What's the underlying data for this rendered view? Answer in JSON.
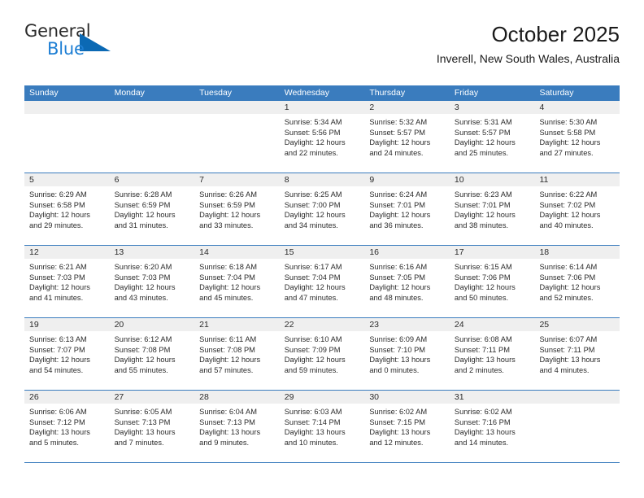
{
  "brand": {
    "name_top": "General",
    "name_bottom": "Blue",
    "triangle_icon": "brand-triangle-icon",
    "color_top": "#2b2b2b",
    "color_bottom": "#1e7fd4"
  },
  "header": {
    "title": "October 2025",
    "subtitle": "Inverell, New South Wales, Australia"
  },
  "theme": {
    "header_bg": "#3a7cbe",
    "header_text": "#ffffff",
    "daynum_bg": "#efefef",
    "cell_bg": "#ffffff",
    "text": "#2b2b2b",
    "rule": "#3a7cbe"
  },
  "calendar": {
    "weekday_headers": [
      "Sunday",
      "Monday",
      "Tuesday",
      "Wednesday",
      "Thursday",
      "Friday",
      "Saturday"
    ],
    "weeks": [
      [
        {
          "day": "",
          "lines": []
        },
        {
          "day": "",
          "lines": []
        },
        {
          "day": "",
          "lines": []
        },
        {
          "day": "1",
          "lines": [
            "Sunrise: 5:34 AM",
            "Sunset: 5:56 PM",
            "Daylight: 12 hours",
            "and 22 minutes."
          ]
        },
        {
          "day": "2",
          "lines": [
            "Sunrise: 5:32 AM",
            "Sunset: 5:57 PM",
            "Daylight: 12 hours",
            "and 24 minutes."
          ]
        },
        {
          "day": "3",
          "lines": [
            "Sunrise: 5:31 AM",
            "Sunset: 5:57 PM",
            "Daylight: 12 hours",
            "and 25 minutes."
          ]
        },
        {
          "day": "4",
          "lines": [
            "Sunrise: 5:30 AM",
            "Sunset: 5:58 PM",
            "Daylight: 12 hours",
            "and 27 minutes."
          ]
        }
      ],
      [
        {
          "day": "5",
          "lines": [
            "Sunrise: 6:29 AM",
            "Sunset: 6:58 PM",
            "Daylight: 12 hours",
            "and 29 minutes."
          ]
        },
        {
          "day": "6",
          "lines": [
            "Sunrise: 6:28 AM",
            "Sunset: 6:59 PM",
            "Daylight: 12 hours",
            "and 31 minutes."
          ]
        },
        {
          "day": "7",
          "lines": [
            "Sunrise: 6:26 AM",
            "Sunset: 6:59 PM",
            "Daylight: 12 hours",
            "and 33 minutes."
          ]
        },
        {
          "day": "8",
          "lines": [
            "Sunrise: 6:25 AM",
            "Sunset: 7:00 PM",
            "Daylight: 12 hours",
            "and 34 minutes."
          ]
        },
        {
          "day": "9",
          "lines": [
            "Sunrise: 6:24 AM",
            "Sunset: 7:01 PM",
            "Daylight: 12 hours",
            "and 36 minutes."
          ]
        },
        {
          "day": "10",
          "lines": [
            "Sunrise: 6:23 AM",
            "Sunset: 7:01 PM",
            "Daylight: 12 hours",
            "and 38 minutes."
          ]
        },
        {
          "day": "11",
          "lines": [
            "Sunrise: 6:22 AM",
            "Sunset: 7:02 PM",
            "Daylight: 12 hours",
            "and 40 minutes."
          ]
        }
      ],
      [
        {
          "day": "12",
          "lines": [
            "Sunrise: 6:21 AM",
            "Sunset: 7:03 PM",
            "Daylight: 12 hours",
            "and 41 minutes."
          ]
        },
        {
          "day": "13",
          "lines": [
            "Sunrise: 6:20 AM",
            "Sunset: 7:03 PM",
            "Daylight: 12 hours",
            "and 43 minutes."
          ]
        },
        {
          "day": "14",
          "lines": [
            "Sunrise: 6:18 AM",
            "Sunset: 7:04 PM",
            "Daylight: 12 hours",
            "and 45 minutes."
          ]
        },
        {
          "day": "15",
          "lines": [
            "Sunrise: 6:17 AM",
            "Sunset: 7:04 PM",
            "Daylight: 12 hours",
            "and 47 minutes."
          ]
        },
        {
          "day": "16",
          "lines": [
            "Sunrise: 6:16 AM",
            "Sunset: 7:05 PM",
            "Daylight: 12 hours",
            "and 48 minutes."
          ]
        },
        {
          "day": "17",
          "lines": [
            "Sunrise: 6:15 AM",
            "Sunset: 7:06 PM",
            "Daylight: 12 hours",
            "and 50 minutes."
          ]
        },
        {
          "day": "18",
          "lines": [
            "Sunrise: 6:14 AM",
            "Sunset: 7:06 PM",
            "Daylight: 12 hours",
            "and 52 minutes."
          ]
        }
      ],
      [
        {
          "day": "19",
          "lines": [
            "Sunrise: 6:13 AM",
            "Sunset: 7:07 PM",
            "Daylight: 12 hours",
            "and 54 minutes."
          ]
        },
        {
          "day": "20",
          "lines": [
            "Sunrise: 6:12 AM",
            "Sunset: 7:08 PM",
            "Daylight: 12 hours",
            "and 55 minutes."
          ]
        },
        {
          "day": "21",
          "lines": [
            "Sunrise: 6:11 AM",
            "Sunset: 7:08 PM",
            "Daylight: 12 hours",
            "and 57 minutes."
          ]
        },
        {
          "day": "22",
          "lines": [
            "Sunrise: 6:10 AM",
            "Sunset: 7:09 PM",
            "Daylight: 12 hours",
            "and 59 minutes."
          ]
        },
        {
          "day": "23",
          "lines": [
            "Sunrise: 6:09 AM",
            "Sunset: 7:10 PM",
            "Daylight: 13 hours",
            "and 0 minutes."
          ]
        },
        {
          "day": "24",
          "lines": [
            "Sunrise: 6:08 AM",
            "Sunset: 7:11 PM",
            "Daylight: 13 hours",
            "and 2 minutes."
          ]
        },
        {
          "day": "25",
          "lines": [
            "Sunrise: 6:07 AM",
            "Sunset: 7:11 PM",
            "Daylight: 13 hours",
            "and 4 minutes."
          ]
        }
      ],
      [
        {
          "day": "26",
          "lines": [
            "Sunrise: 6:06 AM",
            "Sunset: 7:12 PM",
            "Daylight: 13 hours",
            "and 5 minutes."
          ]
        },
        {
          "day": "27",
          "lines": [
            "Sunrise: 6:05 AM",
            "Sunset: 7:13 PM",
            "Daylight: 13 hours",
            "and 7 minutes."
          ]
        },
        {
          "day": "28",
          "lines": [
            "Sunrise: 6:04 AM",
            "Sunset: 7:13 PM",
            "Daylight: 13 hours",
            "and 9 minutes."
          ]
        },
        {
          "day": "29",
          "lines": [
            "Sunrise: 6:03 AM",
            "Sunset: 7:14 PM",
            "Daylight: 13 hours",
            "and 10 minutes."
          ]
        },
        {
          "day": "30",
          "lines": [
            "Sunrise: 6:02 AM",
            "Sunset: 7:15 PM",
            "Daylight: 13 hours",
            "and 12 minutes."
          ]
        },
        {
          "day": "31",
          "lines": [
            "Sunrise: 6:02 AM",
            "Sunset: 7:16 PM",
            "Daylight: 13 hours",
            "and 14 minutes."
          ]
        },
        {
          "day": "",
          "lines": []
        }
      ]
    ]
  }
}
